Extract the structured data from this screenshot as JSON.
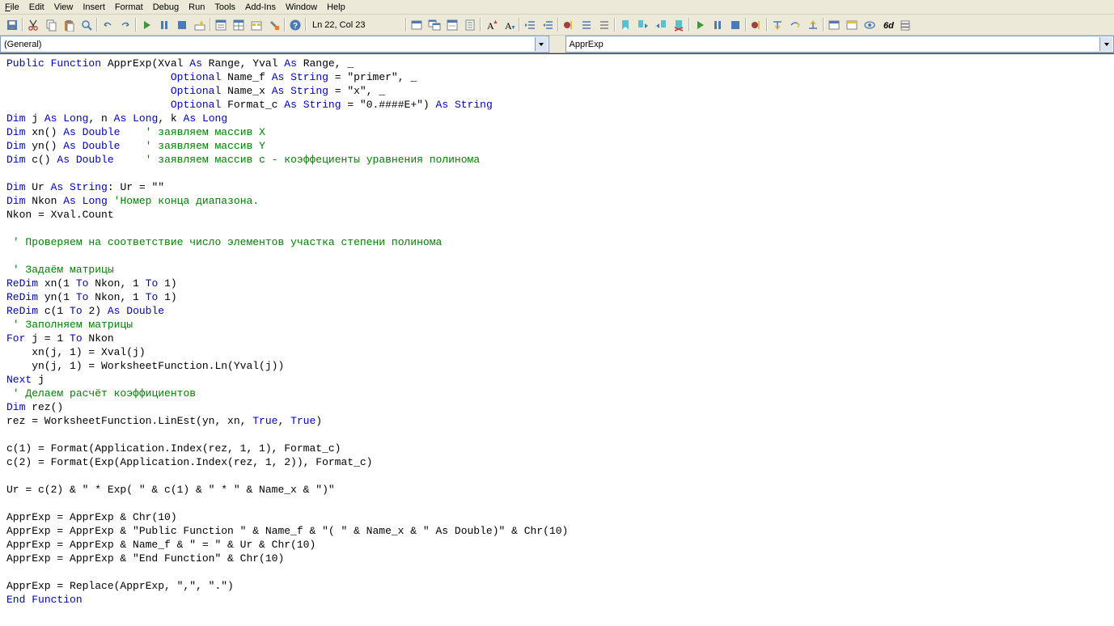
{
  "menus": {
    "file": "File",
    "edit": "Edit",
    "view": "View",
    "insert": "Insert",
    "format": "Format",
    "debug": "Debug",
    "run": "Run",
    "tools": "Tools",
    "addins": "Add-Ins",
    "window": "Window",
    "help": "Help"
  },
  "cursor_pos": "Ln 22, Col 23",
  "left_dropdown": "(General)",
  "right_dropdown": "ApprExp",
  "code_tokens": [
    [
      "kw",
      "Public"
    ],
    [
      "",
      " "
    ],
    [
      "kw",
      "Function"
    ],
    [
      "",
      " ApprExp(Xval "
    ],
    [
      "kw",
      "As"
    ],
    [
      "",
      " Range, Yval "
    ],
    [
      "kw",
      "As"
    ],
    [
      "",
      " Range, _"
    ],
    [
      "nl",
      ""
    ],
    [
      "",
      "                          "
    ],
    [
      "kw",
      "Optional"
    ],
    [
      "",
      " Name_f "
    ],
    [
      "kw",
      "As"
    ],
    [
      "",
      " "
    ],
    [
      "kw",
      "String"
    ],
    [
      "",
      " = \"primer\", _"
    ],
    [
      "nl",
      ""
    ],
    [
      "",
      "                          "
    ],
    [
      "kw",
      "Optional"
    ],
    [
      "",
      " Name_x "
    ],
    [
      "kw",
      "As"
    ],
    [
      "",
      " "
    ],
    [
      "kw",
      "String"
    ],
    [
      "",
      " = \"x\", _"
    ],
    [
      "nl",
      ""
    ],
    [
      "",
      "                          "
    ],
    [
      "kw",
      "Optional"
    ],
    [
      "",
      " Format_c "
    ],
    [
      "kw",
      "As"
    ],
    [
      "",
      " "
    ],
    [
      "kw",
      "String"
    ],
    [
      "",
      " = \"0.####E+\") "
    ],
    [
      "kw",
      "As"
    ],
    [
      "",
      " "
    ],
    [
      "kw",
      "String"
    ],
    [
      "nl",
      ""
    ],
    [
      "kw",
      "Dim"
    ],
    [
      "",
      " j "
    ],
    [
      "kw",
      "As"
    ],
    [
      "",
      " "
    ],
    [
      "kw",
      "Long"
    ],
    [
      "",
      ", n "
    ],
    [
      "kw",
      "As"
    ],
    [
      "",
      " "
    ],
    [
      "kw",
      "Long"
    ],
    [
      "",
      ", k "
    ],
    [
      "kw",
      "As"
    ],
    [
      "",
      " "
    ],
    [
      "kw",
      "Long"
    ],
    [
      "nl",
      ""
    ],
    [
      "kw",
      "Dim"
    ],
    [
      "",
      " xn() "
    ],
    [
      "kw",
      "As"
    ],
    [
      "",
      " "
    ],
    [
      "kw",
      "Double"
    ],
    [
      "",
      "    "
    ],
    [
      "cm",
      "' заявляем массив X"
    ],
    [
      "nl",
      ""
    ],
    [
      "kw",
      "Dim"
    ],
    [
      "",
      " yn() "
    ],
    [
      "kw",
      "As"
    ],
    [
      "",
      " "
    ],
    [
      "kw",
      "Double"
    ],
    [
      "",
      "    "
    ],
    [
      "cm",
      "' заявляем массив Y"
    ],
    [
      "nl",
      ""
    ],
    [
      "kw",
      "Dim"
    ],
    [
      "",
      " c() "
    ],
    [
      "kw",
      "As"
    ],
    [
      "",
      " "
    ],
    [
      "kw",
      "Double"
    ],
    [
      "",
      "     "
    ],
    [
      "cm",
      "' заявляем массив с - коэффециенты уравнения полинома"
    ],
    [
      "nl",
      ""
    ],
    [
      "nl",
      ""
    ],
    [
      "kw",
      "Dim"
    ],
    [
      "",
      " Ur "
    ],
    [
      "kw",
      "As"
    ],
    [
      "",
      " "
    ],
    [
      "kw",
      "String"
    ],
    [
      "",
      ": Ur = \"\""
    ],
    [
      "nl",
      ""
    ],
    [
      "kw",
      "Dim"
    ],
    [
      "",
      " Nkon "
    ],
    [
      "kw",
      "As"
    ],
    [
      "",
      " "
    ],
    [
      "kw",
      "Long"
    ],
    [
      "",
      " "
    ],
    [
      "cm",
      "'Номер конца диапазона."
    ],
    [
      "nl",
      ""
    ],
    [
      "",
      "Nkon = Xval.Count"
    ],
    [
      "nl",
      ""
    ],
    [
      "nl",
      ""
    ],
    [
      "",
      " "
    ],
    [
      "cm",
      "' Проверяем на соответствие число элементов участка степени полинома"
    ],
    [
      "nl",
      ""
    ],
    [
      "nl",
      ""
    ],
    [
      "",
      " "
    ],
    [
      "cm",
      "' Задаём матрицы"
    ],
    [
      "nl",
      ""
    ],
    [
      "kw",
      "ReDim"
    ],
    [
      "",
      " xn(1 "
    ],
    [
      "kw",
      "To"
    ],
    [
      "",
      " Nkon, 1 "
    ],
    [
      "kw",
      "To"
    ],
    [
      "",
      " 1)"
    ],
    [
      "nl",
      ""
    ],
    [
      "kw",
      "ReDim"
    ],
    [
      "",
      " yn(1 "
    ],
    [
      "kw",
      "To"
    ],
    [
      "",
      " Nkon, 1 "
    ],
    [
      "kw",
      "To"
    ],
    [
      "",
      " 1)"
    ],
    [
      "nl",
      ""
    ],
    [
      "kw",
      "ReDim"
    ],
    [
      "",
      " c(1 "
    ],
    [
      "kw",
      "To"
    ],
    [
      "",
      " 2) "
    ],
    [
      "kw",
      "As"
    ],
    [
      "",
      " "
    ],
    [
      "kw",
      "Double"
    ],
    [
      "nl",
      ""
    ],
    [
      "",
      " "
    ],
    [
      "cm",
      "' Заполняем матрицы"
    ],
    [
      "nl",
      ""
    ],
    [
      "kw",
      "For"
    ],
    [
      "",
      " j = 1 "
    ],
    [
      "kw",
      "To"
    ],
    [
      "",
      " Nkon"
    ],
    [
      "nl",
      ""
    ],
    [
      "",
      "    xn(j, 1) = Xval(j)"
    ],
    [
      "nl",
      ""
    ],
    [
      "",
      "    yn(j, 1) = WorksheetFunction.Ln(Yval(j))"
    ],
    [
      "nl",
      ""
    ],
    [
      "kw",
      "Next"
    ],
    [
      "",
      " j"
    ],
    [
      "nl",
      ""
    ],
    [
      "",
      " "
    ],
    [
      "cm",
      "' Делаем расчёт коэффициентов"
    ],
    [
      "nl",
      ""
    ],
    [
      "kw",
      "Dim"
    ],
    [
      "",
      " rez()"
    ],
    [
      "nl",
      ""
    ],
    [
      "",
      "rez = WorksheetFunction.LinEst(yn, xn, "
    ],
    [
      "kw",
      "True"
    ],
    [
      "",
      ", "
    ],
    [
      "kw",
      "True"
    ],
    [
      "",
      ")"
    ],
    [
      "nl",
      ""
    ],
    [
      "nl",
      ""
    ],
    [
      "",
      "c(1) = Format(Application.Index(rez, 1, 1), Format_c)"
    ],
    [
      "nl",
      ""
    ],
    [
      "",
      "c(2) = Format(Exp(Application.Index(rez, 1, 2)), Format_c)"
    ],
    [
      "nl",
      ""
    ],
    [
      "nl",
      ""
    ],
    [
      "",
      "Ur = c(2) & \" * Exp( \" & c(1) & \" * \" & Name_x & \")\""
    ],
    [
      "nl",
      ""
    ],
    [
      "nl",
      ""
    ],
    [
      "",
      "ApprExp = ApprExp & Chr(10)"
    ],
    [
      "nl",
      ""
    ],
    [
      "",
      "ApprExp = ApprExp & \"Public Function \" & Name_f & \"( \" & Name_x & \" As Double)\" & Chr(10)"
    ],
    [
      "nl",
      ""
    ],
    [
      "",
      "ApprExp = ApprExp & Name_f & \" = \" & Ur & Chr(10)"
    ],
    [
      "nl",
      ""
    ],
    [
      "",
      "ApprExp = ApprExp & \"End Function\" & Chr(10)"
    ],
    [
      "nl",
      ""
    ],
    [
      "nl",
      ""
    ],
    [
      "",
      "ApprExp = Replace(ApprExp, \",\", \".\")"
    ],
    [
      "nl",
      ""
    ],
    [
      "kw",
      "End"
    ],
    [
      "",
      " "
    ],
    [
      "kw",
      "Function"
    ],
    [
      "nl",
      ""
    ]
  ]
}
